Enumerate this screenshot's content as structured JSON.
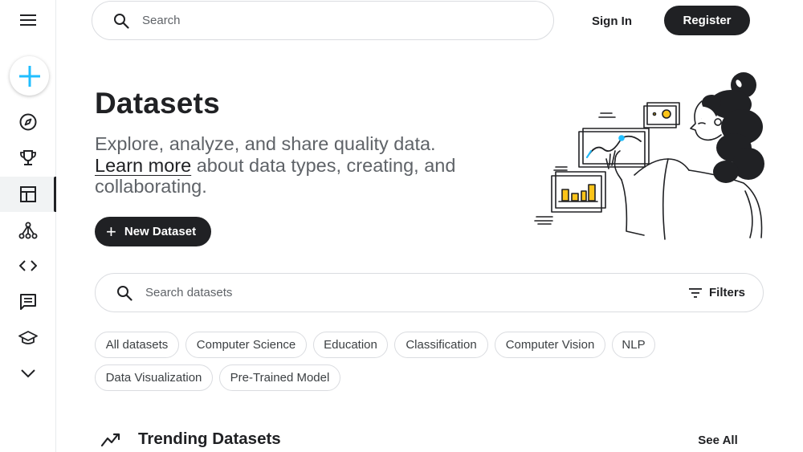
{
  "sidebar": {
    "menu_icon": "menu-icon",
    "create_icon": "plus-icon",
    "items": [
      {
        "icon": "compass-icon"
      },
      {
        "icon": "trophy-icon"
      },
      {
        "icon": "table-icon",
        "active": true
      },
      {
        "icon": "models-icon"
      },
      {
        "icon": "code-icon"
      },
      {
        "icon": "discussion-icon"
      },
      {
        "icon": "learn-icon"
      },
      {
        "icon": "chevron-down-icon"
      }
    ]
  },
  "header": {
    "search_placeholder": "Search",
    "sign_in": "Sign In",
    "register": "Register"
  },
  "hero": {
    "title": "Datasets",
    "line1": "Explore, analyze, and share quality data.",
    "learn_more": "Learn more",
    "line2_rest": " about data types, creating, and collaborating.",
    "new_dataset": "New Dataset"
  },
  "dataset_search": {
    "placeholder": "Search datasets",
    "filters_label": "Filters"
  },
  "chips": [
    "All datasets",
    "Computer Science",
    "Education",
    "Classification",
    "Computer Vision",
    "NLP",
    "Data Visualization",
    "Pre-Trained Model"
  ],
  "trending": {
    "title": "Trending Datasets",
    "see_all": "See All"
  },
  "colors": {
    "accent": "#20beff",
    "primary_dark": "#202124",
    "chart_yellow": "#fcc419"
  }
}
